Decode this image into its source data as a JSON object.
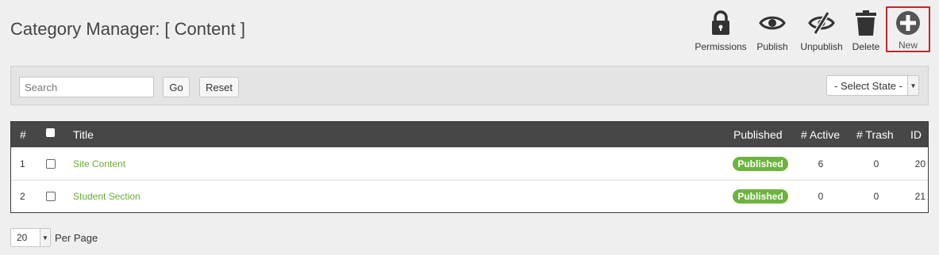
{
  "page": {
    "title": "Category Manager: [ Content ]"
  },
  "toolbar": {
    "permissions": "Permissions",
    "publish": "Publish",
    "unpublish": "Unpublish",
    "delete": "Delete",
    "new": "New"
  },
  "icons": {
    "permissions": "lock-icon",
    "publish": "eye-icon",
    "unpublish": "eye-slash-icon",
    "delete": "trash-icon",
    "new": "plus-circle-icon"
  },
  "filter": {
    "search_placeholder": "Search",
    "search_value": "",
    "go": "Go",
    "reset": "Reset",
    "state_selected": "- Select State -"
  },
  "table": {
    "headers": {
      "num": "#",
      "title": "Title",
      "published": "Published",
      "active": "# Active",
      "trash": "# Trash",
      "id": "ID"
    },
    "rows": [
      {
        "num": "1",
        "title": "Site Content",
        "status": "Published",
        "active": "6",
        "trash": "0",
        "id": "20"
      },
      {
        "num": "2",
        "title": "Student Section",
        "status": "Published",
        "active": "0",
        "trash": "0",
        "id": "21"
      }
    ]
  },
  "pagination": {
    "per_page_value": "20",
    "per_page_label": "Per Page"
  },
  "colors": {
    "accent_green": "#6db33f",
    "link_green": "#6aab38",
    "header_dark": "#474747",
    "highlight_red": "#c0282d"
  }
}
